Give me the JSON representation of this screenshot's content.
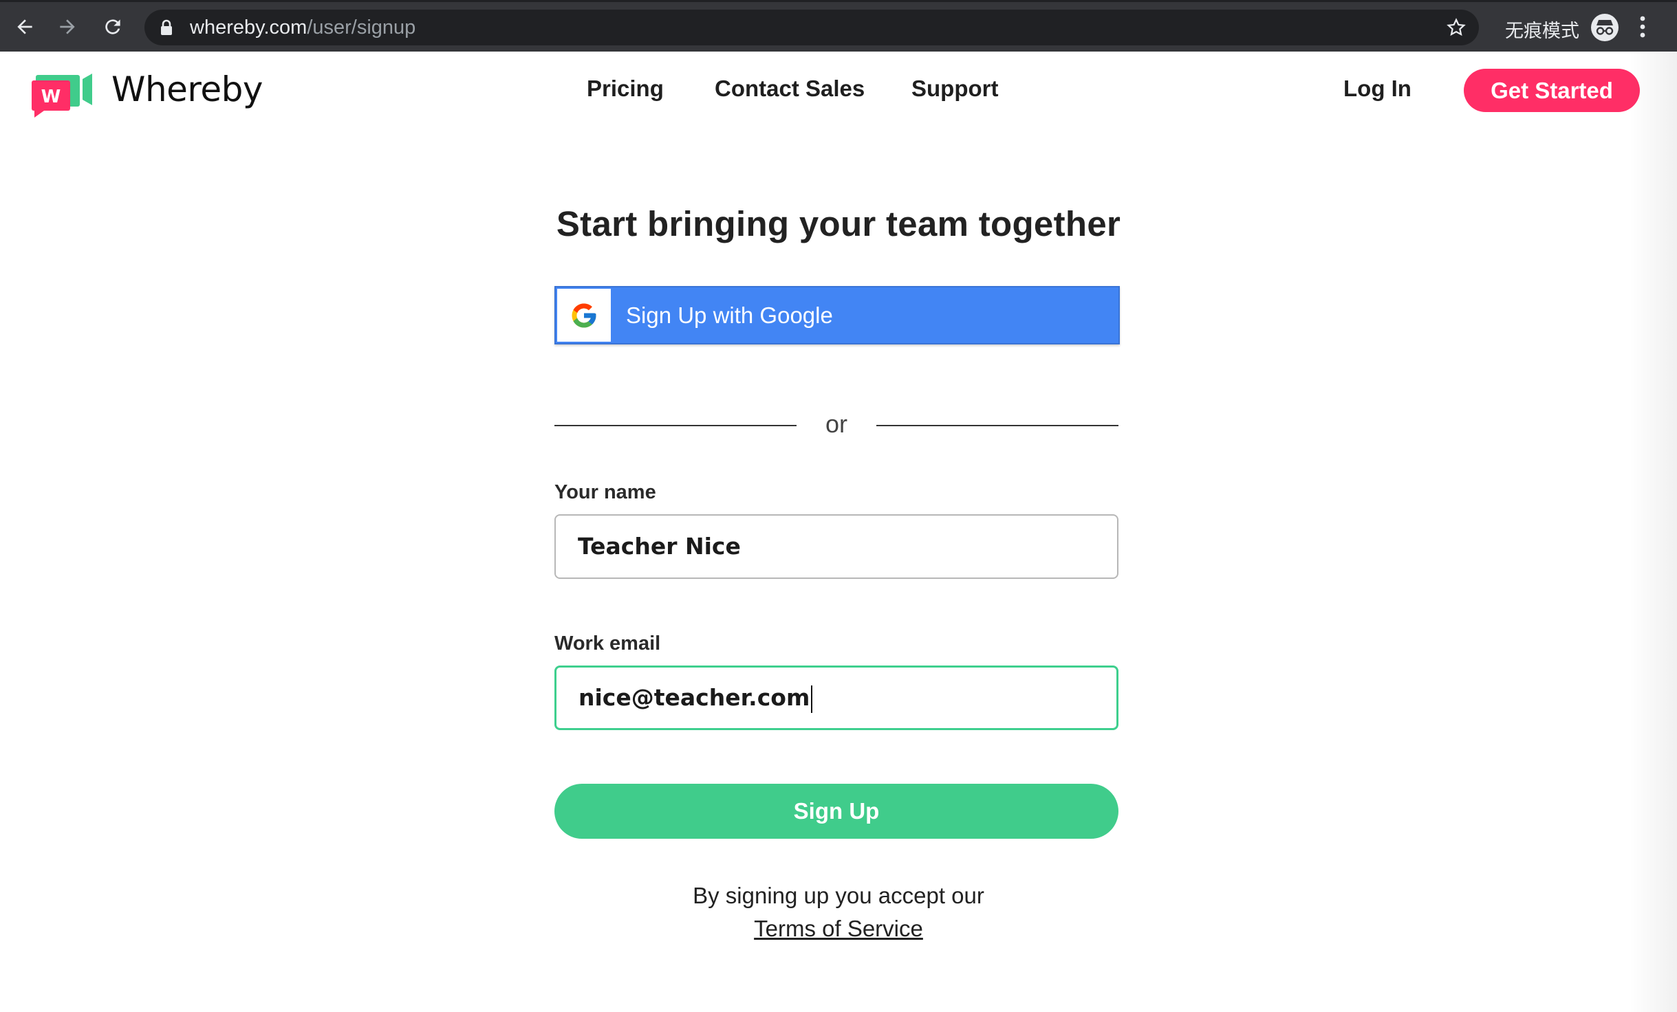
{
  "browser": {
    "url_host": "whereby.com",
    "url_path": "/user/signup",
    "incognito_label": "无痕模式",
    "icons": [
      "back-icon",
      "forward-icon",
      "reload-icon",
      "lock-icon",
      "star-icon",
      "incognito-icon",
      "kebab-menu-icon"
    ]
  },
  "header": {
    "logo_text": "Whereby",
    "nav": [
      "Pricing",
      "Contact Sales",
      "Support"
    ],
    "login": "Log In",
    "cta": "Get Started"
  },
  "signup": {
    "title": "Start bringing your team together",
    "google_button": "Sign Up with Google",
    "or_text": "or",
    "name_label": "Your name",
    "name_value": "Teacher Nice",
    "email_label": "Work email",
    "email_value": "nice@teacher.com",
    "submit": "Sign Up",
    "terms_text": "By signing up you accept our",
    "terms_link": "Terms of Service"
  },
  "colors": {
    "brand_pink": "#ff2e66",
    "brand_green": "#40cc8b",
    "google_blue": "#4285f4",
    "focus_border": "#3ecf8e"
  }
}
